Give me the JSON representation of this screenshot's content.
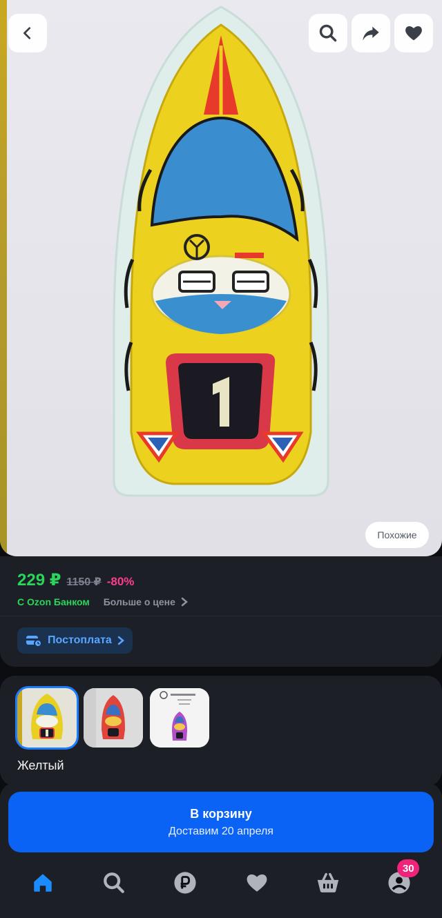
{
  "gallery": {
    "similar_label": "Похожие"
  },
  "price": {
    "current": "229 ₽",
    "old": "1150 ₽",
    "discount": "-80%",
    "bank_label": "С Ozon Банком",
    "more_label": "Больше о цене",
    "postpay_label": "Постоплата",
    "colors": {
      "price": "#2bd45a",
      "discount": "#ff3d8f",
      "accent": "#0a63f5"
    }
  },
  "variants": {
    "selected_name": "Желтый",
    "thumbs": [
      "yellow-boat",
      "red-boat",
      "pink-boat-certificate"
    ]
  },
  "cart": {
    "title": "В корзину",
    "subtitle": "Доставим 20 апреля"
  },
  "nav": {
    "items": [
      "home-icon",
      "search-icon",
      "ruble-icon",
      "heart-icon",
      "basket-icon",
      "profile-icon"
    ],
    "profile_badge": "30"
  }
}
